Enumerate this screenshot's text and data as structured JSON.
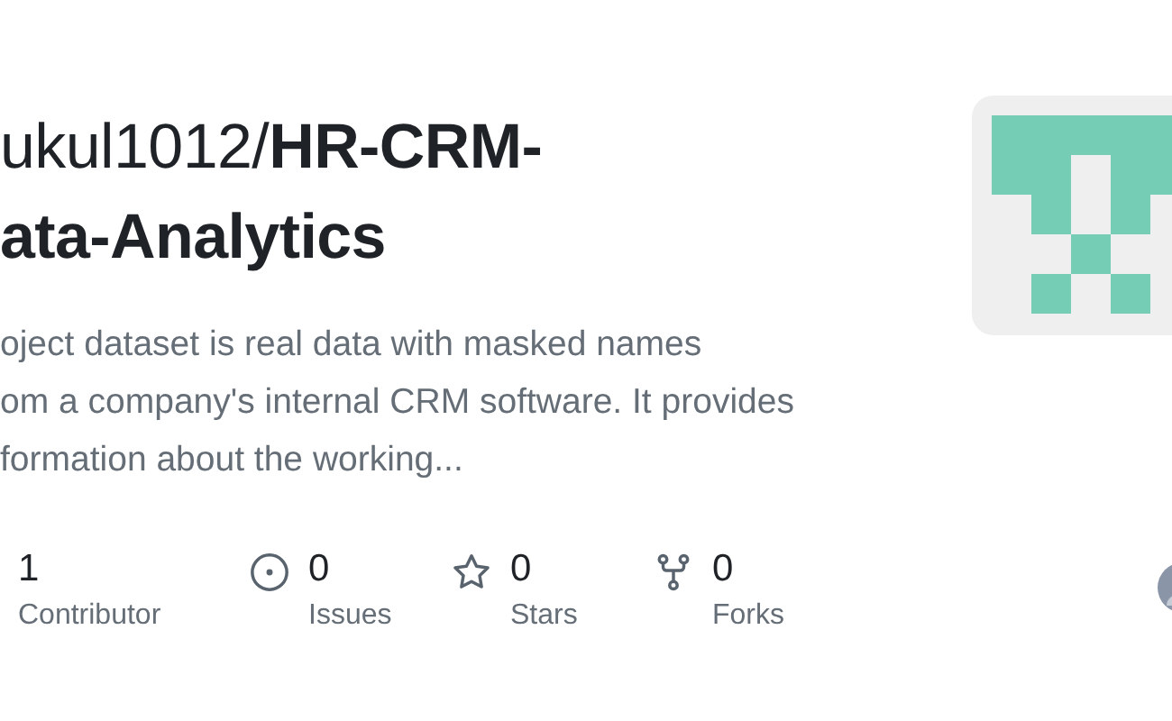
{
  "title": {
    "owner": "ukul1012/",
    "repo_lines": [
      "HR-CRM-",
      "ata-Analytics"
    ]
  },
  "description_lines": [
    "oject dataset is real data with masked names",
    "om a company's internal CRM software. It provides",
    "formation about the working..."
  ],
  "stats": [
    {
      "kind": "contributors",
      "value": "1",
      "label": "Contributor"
    },
    {
      "kind": "issues",
      "value": "0",
      "label": "Issues"
    },
    {
      "kind": "stars",
      "value": "0",
      "label": "Stars"
    },
    {
      "kind": "forks",
      "value": "0",
      "label": "Forks"
    }
  ]
}
